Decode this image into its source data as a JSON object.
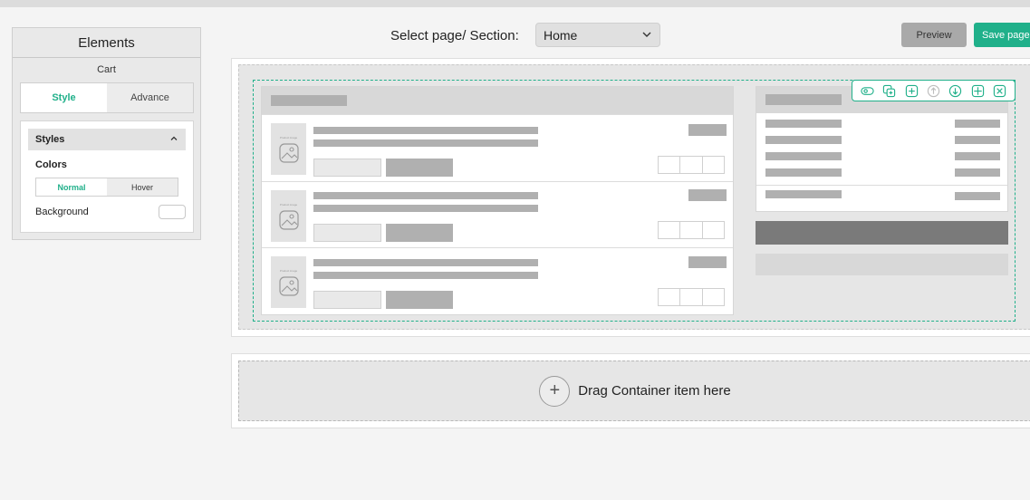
{
  "topbar": {
    "breadcrumb": ""
  },
  "panel": {
    "title": "Elements",
    "subtitle": "Cart",
    "tabs": [
      "Style",
      "Advance"
    ],
    "active_tab": "Style",
    "styles": {
      "header": "Styles",
      "colors_label": "Colors",
      "states": [
        "Normal",
        "Hover"
      ],
      "active_state": "Normal",
      "background_label": "Background",
      "background_color": "#ffffff"
    }
  },
  "header": {
    "select_label": "Select page/ Section:",
    "select_value": "Home",
    "preview_label": "Preview",
    "save_label": "Save page"
  },
  "toolbar_icons": [
    "eye-icon",
    "duplicate-icon",
    "add-icon",
    "move-up-icon",
    "move-down-icon",
    "move-icon",
    "close-icon"
  ],
  "drop_zone": {
    "label": "Drag Container item here"
  },
  "thumb_label": "Product image",
  "colors": {
    "accent": "#20b08a",
    "preview_bg": "#a9a9a9"
  }
}
